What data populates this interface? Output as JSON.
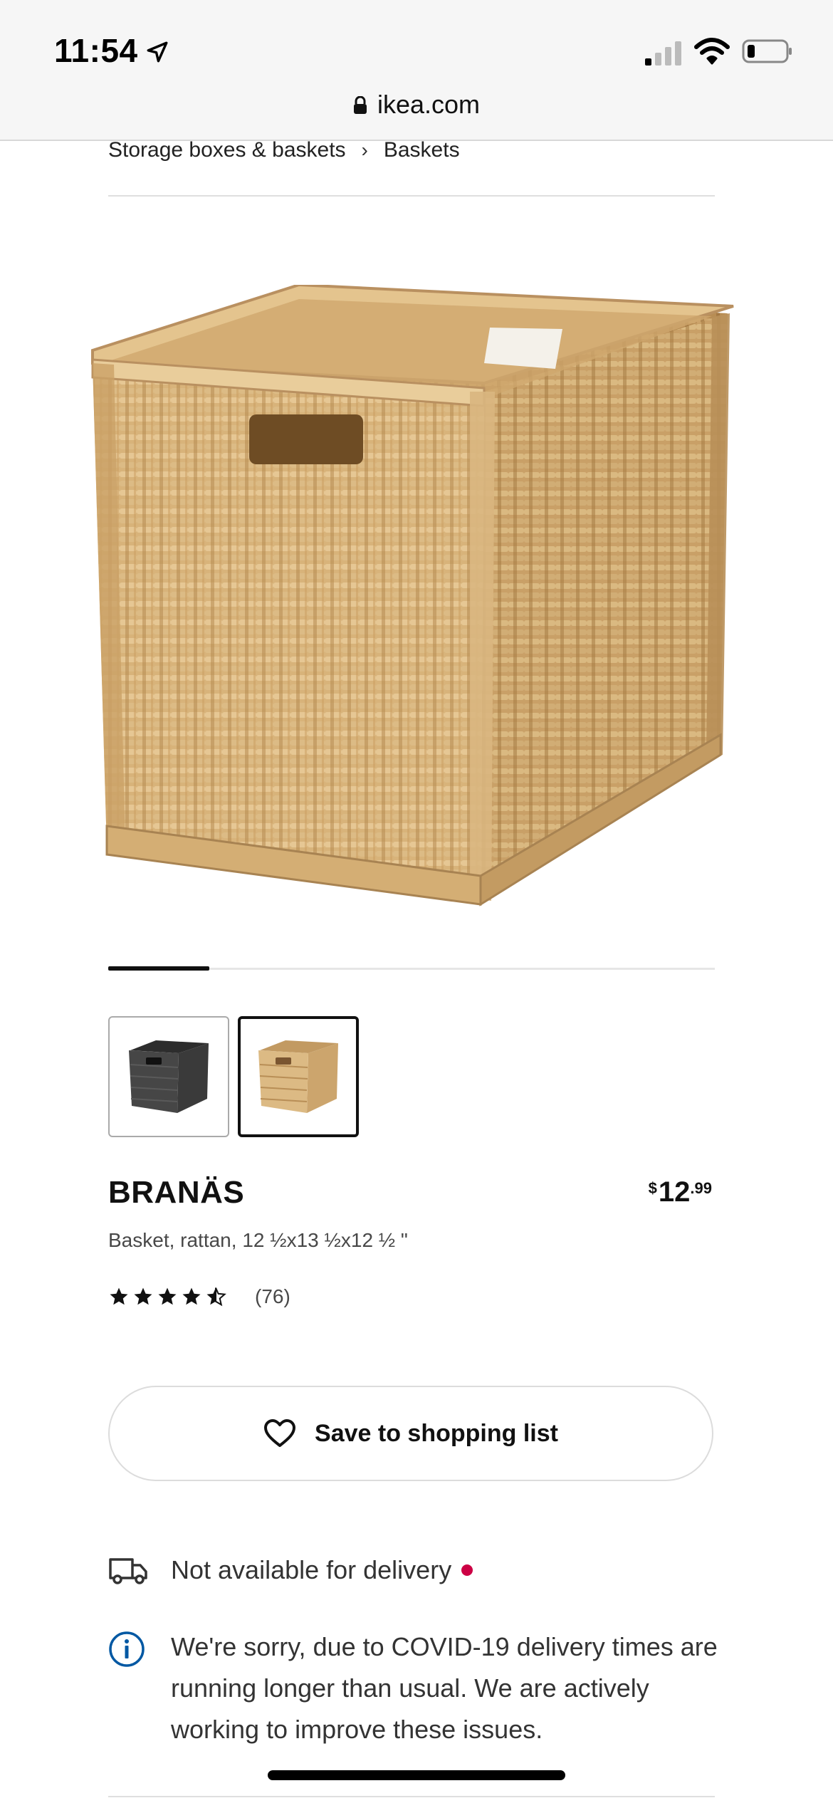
{
  "status_bar": {
    "time": "11:54",
    "icons": [
      "location-arrow-icon",
      "cellular-signal-icon",
      "wifi-icon",
      "battery-icon"
    ]
  },
  "browser": {
    "url": "ikea.com",
    "lock_icon": "lock-icon"
  },
  "breadcrumb": {
    "items": [
      "Storage boxes & baskets",
      "Baskets"
    ],
    "separator": "›"
  },
  "gallery": {
    "hero_icon": "rattan-basket-image",
    "thumbnails": [
      {
        "name": "dark-gray-basket-thumbnail",
        "selected": false
      },
      {
        "name": "natural-rattan-basket-thumbnail",
        "selected": true
      }
    ],
    "slider_position": "1 of 6"
  },
  "product": {
    "name": "BRANÄS",
    "price_currency": "$",
    "price_integer": "12",
    "price_decimal": ".99",
    "description": "Basket, rattan, 12 ½x13 ½x12 ½ \"",
    "rating_value": 4.5,
    "rating_count": "(76)"
  },
  "actions": {
    "save_label": "Save to shopping list",
    "save_icon": "heart-icon"
  },
  "availability": {
    "delivery_text": "Not available for delivery",
    "delivery_icon": "truck-icon",
    "status_color": "#cc0044",
    "notice_text": "We're sorry, due to COVID-19 delivery times are running longer than usual. We are actively working to improve these issues.",
    "notice_icon": "info-icon"
  },
  "colors": {
    "text": "#111111",
    "muted": "#484848",
    "info_blue": "#0058a3"
  }
}
